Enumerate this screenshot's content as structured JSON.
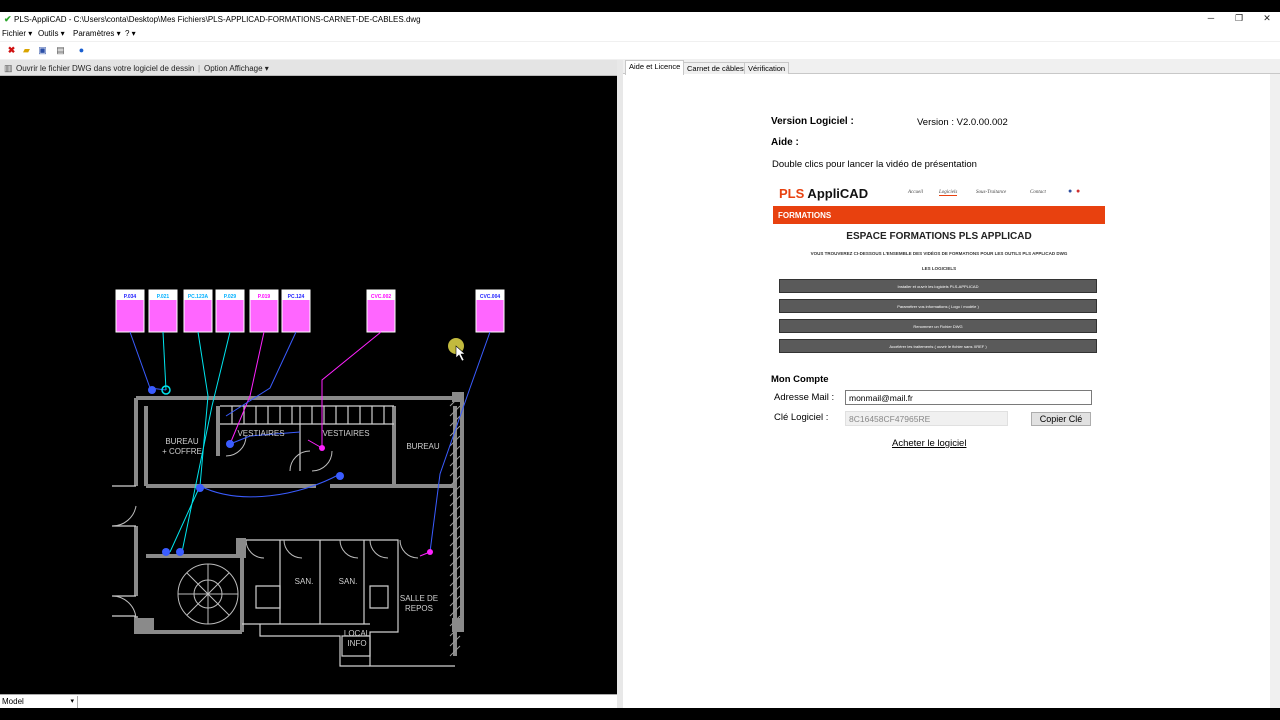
{
  "window": {
    "title": "PLS-AppliCAD - C:\\Users\\conta\\Desktop\\Mes Fichiers\\PLS-APPLICAD-FORMATIONS-CARNET-DE-CABLES.dwg",
    "minimize": "─",
    "restore": "❐",
    "close": "✕"
  },
  "menu": {
    "file": "Fichier",
    "tools": "Outils",
    "settings": "Paramètres",
    "help": "?"
  },
  "dwg_toolbar": {
    "open_dwg": "Ouvrir le fichier DWG dans votre logiciel de dessin",
    "display_option": "Option Affichage"
  },
  "drawing": {
    "rooms": {
      "bureau_coffre_1": "BUREAU",
      "bureau_coffre_2": "+ COFFRE",
      "vestiaires_1": "VESTIAIRES",
      "vestiaires_2": "VESTIAIRES",
      "bureau": "BUREAU",
      "san_1": "SAN.",
      "san_2": "SAN.",
      "salle_repos_1": "SALLE DE",
      "salle_repos_2": "REPOS",
      "local_info_1": "LOCAL",
      "local_info_2": "INFO"
    },
    "tags": [
      "P.034",
      "P.021",
      "PC.123A",
      "P.029",
      "P.019",
      "PC.124",
      "CVC.002",
      "CVC.004"
    ],
    "colors": {
      "white": "#dcdcdc",
      "cyan": "#00e5ee",
      "blue": "#2020ff",
      "magenta": "#ff22ff",
      "wall": "#8a8a8a"
    }
  },
  "status": {
    "layout": "Model"
  },
  "tabs": [
    "Aide et Licence",
    "Carnet de câbles",
    "Vérification"
  ],
  "help_panel": {
    "version_label": "Version Logiciel :",
    "version_value": "Version : V2.0.00.002",
    "aide_label": "Aide :",
    "video_hint": "Double clics pour lancer la vidéo de présentation",
    "promo": {
      "brand_red": "PLS",
      "brand_black": " AppliCAD",
      "nav": [
        "Accueil",
        "Logiciels",
        "Sous-Traitance",
        "Contact"
      ],
      "banner": "FORMATIONS",
      "heading": "ESPACE FORMATIONS PLS APPLICAD",
      "subheading": "VOUS TROUVEREZ CI-DESSOUS L'ENSEMBLE DES VIDÉOS DE FORMATIONS POUR LES OUTILS PLS APPLICAD DWG",
      "section": "LES LOGICIELS",
      "buttons": [
        "Installer et ouvrir les logiciels PLS-APPLICAD",
        "Paramétrer vos informations ( Logo / modèle )",
        "Renommer un Fichier DWG",
        "Accélérer les traitements ( ouvrir le fichier sans XREF )"
      ]
    },
    "account_label": "Mon Compte",
    "email_label": "Adresse Mail :",
    "email_value": "monmail@mail.fr",
    "key_label": "Clé Logiciel :",
    "key_value": "8C16458CF47965RE",
    "copy_button": "Copier Clé",
    "buy_link": "Acheter le logiciel"
  }
}
